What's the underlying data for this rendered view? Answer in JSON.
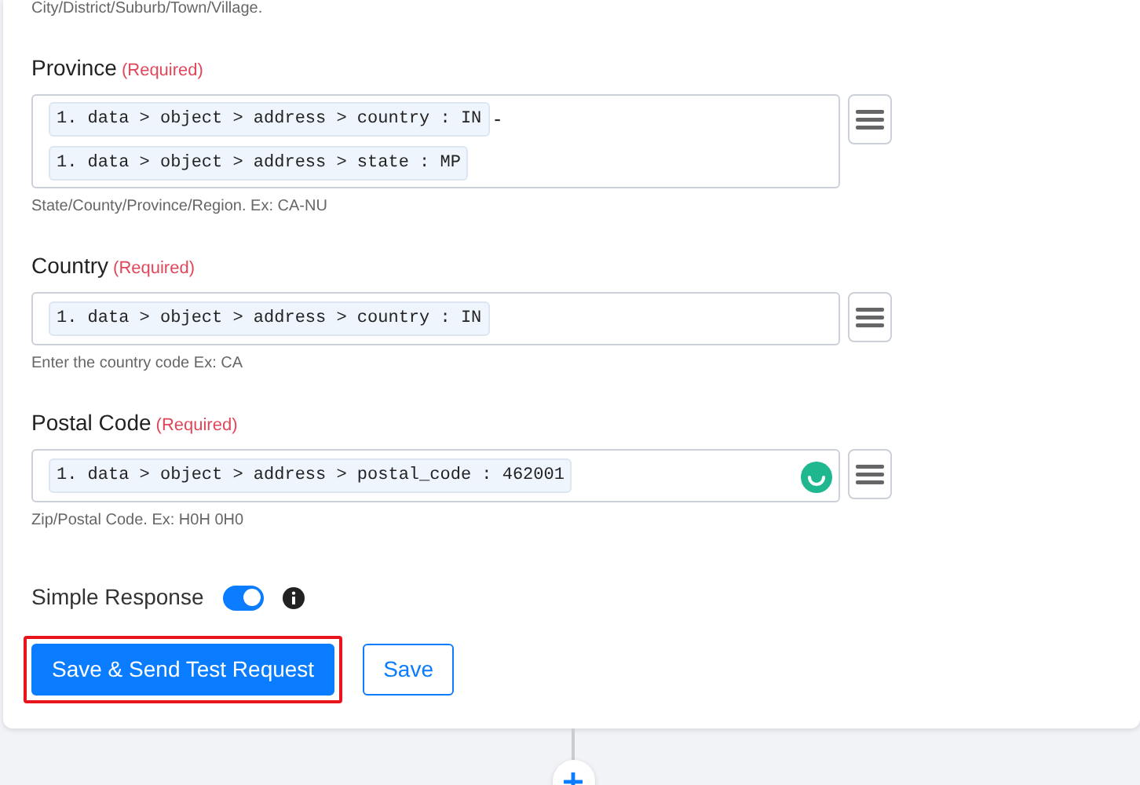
{
  "top_hint": "City/District/Suburb/Town/Village.",
  "fields": [
    {
      "label": "Province",
      "required": "(Required)",
      "busy": false,
      "hint": "State/County/Province/Region. Ex: CA-NU",
      "value": [
        {
          "kind": "chip",
          "text": "1. data > object > address > country : IN"
        },
        {
          "kind": "text",
          "text": "-"
        },
        {
          "kind": "chip",
          "text": "1. data > object > address > state : MP"
        }
      ]
    },
    {
      "label": "Country",
      "required": "(Required)",
      "busy": false,
      "hint": "Enter the country code Ex: CA",
      "value": [
        {
          "kind": "chip",
          "text": "1. data > object > address > country : IN"
        }
      ]
    },
    {
      "label": "Postal Code",
      "required": "(Required)",
      "busy": true,
      "hint": "Zip/Postal Code. Ex: H0H 0H0",
      "value": [
        {
          "kind": "chip",
          "text": "1. data > object > address > postal_code : 462001"
        }
      ]
    }
  ],
  "simple_response": {
    "label": "Simple Response",
    "on": true
  },
  "buttons": [
    {
      "label": "Save & Send Test Request",
      "kind": "primary",
      "highlighted": true
    },
    {
      "label": "Save",
      "kind": "outline",
      "highlighted": false
    }
  ]
}
